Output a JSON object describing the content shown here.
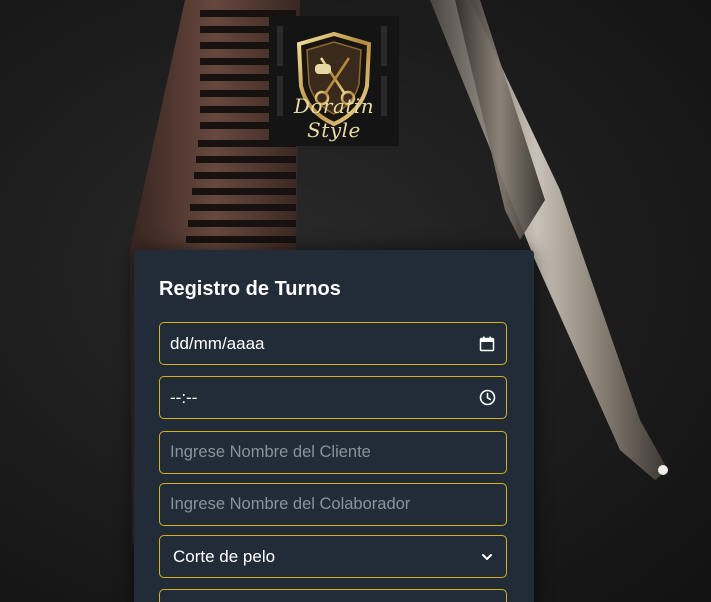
{
  "logo": {
    "text": "Doratin Style",
    "icon": "shield-scissors-emblem-icon"
  },
  "form": {
    "title": "Registro de Turnos",
    "date_field": {
      "placeholder": "dd/mm/aaaa",
      "icon": "calendar-icon"
    },
    "time_field": {
      "placeholder": "--:--",
      "icon": "clock-icon"
    },
    "client_field": {
      "placeholder": "Ingrese Nombre del Cliente"
    },
    "collaborator_field": {
      "placeholder": "Ingrese Nombre del Colaborador"
    },
    "service_select": {
      "selected": "Corte de pelo",
      "icon": "chevron-down-icon"
    }
  },
  "colors": {
    "card_bg": "#222c38",
    "field_border": "#d4b21c",
    "text": "#ffffff",
    "placeholder": "#8b929a",
    "logo_gold": "#e8d9a4"
  }
}
